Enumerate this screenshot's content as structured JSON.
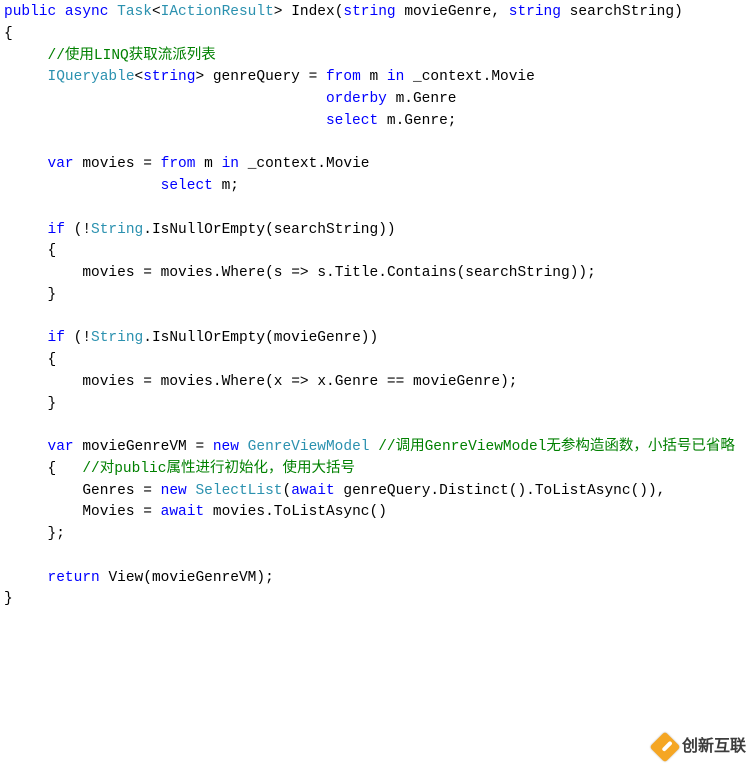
{
  "watermark": "创新互联",
  "tokens": {
    "0": "public",
    "1": "async",
    "2": "Task",
    "3": "IActionResult",
    "4": "Index",
    "5": "string",
    "6": "movieGenre",
    "7": "string",
    "8": "searchString",
    "9": "//使用LINQ获取流派列表",
    "10": "IQueryable",
    "11": "string",
    "12": "genreQuery",
    "13": "from",
    "14": "m",
    "15": "in",
    "16": "_context.Movie",
    "17": "orderby",
    "18": "m.Genre",
    "19": "select",
    "20": "m.Genre",
    "21": "var",
    "22": "movies",
    "23": "from",
    "24": "m",
    "25": "in",
    "26": "_context.Movie",
    "27": "select",
    "28": "m",
    "29": "if",
    "30": "String",
    "31": "IsNullOrEmpty",
    "32": "searchString",
    "33": "movies",
    "34": "movies",
    "35": "Where",
    "36": "s",
    "37": "s",
    "38": "Title",
    "39": "Contains",
    "40": "searchString",
    "41": "if",
    "42": "String",
    "43": "IsNullOrEmpty",
    "44": "movieGenre",
    "45": "movies",
    "46": "movies",
    "47": "Where",
    "48": "x",
    "49": "x",
    "50": "Genre",
    "51": "movieGenre",
    "52": "var",
    "53": "movieGenreVM",
    "54": "new",
    "55": "GenreViewModel",
    "56": "//调用GenreViewModel无参构造函数，小括号已省略",
    "57": "//对public属性进行初始化，使用大括号",
    "58": "Genres",
    "59": "new",
    "60": "SelectList",
    "61": "await",
    "62": "genreQuery",
    "63": "Distinct",
    "64": "ToListAsync",
    "65": "Movies",
    "66": "await",
    "67": "movies",
    "68": "ToListAsync",
    "69": "return",
    "70": "View",
    "71": "movieGenreVM"
  }
}
